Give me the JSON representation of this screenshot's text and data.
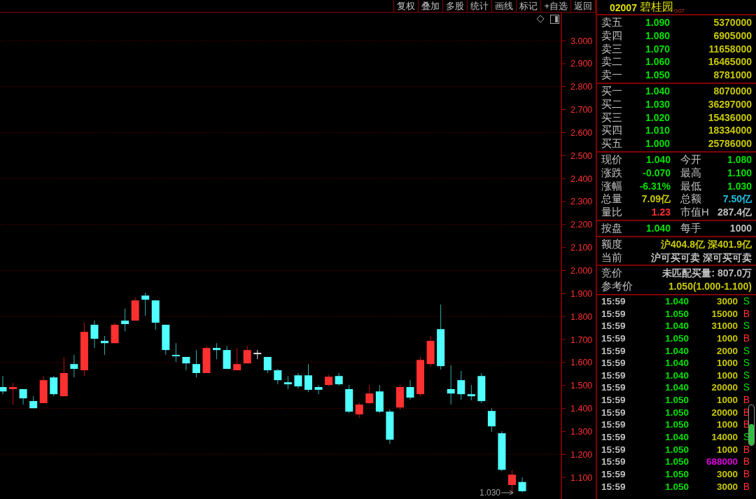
{
  "toolbar": {
    "buttons": [
      "复权",
      "叠加",
      "多股",
      "统计",
      "画线",
      "标记",
      "+自选",
      "返回"
    ]
  },
  "chart": {
    "low_marker": "1.030",
    "chart_data": {
      "type": "candlestick",
      "grid": true,
      "ylim": [
        1.006,
        3.122
      ],
      "ohlc": [
        [
          1.493,
          1.541,
          1.462,
          1.474
        ],
        [
          1.484,
          1.511,
          1.417,
          1.493
        ],
        [
          1.484,
          1.484,
          1.417,
          1.444
        ],
        [
          1.432,
          1.453,
          1.401,
          1.401
        ],
        [
          1.423,
          1.541,
          1.423,
          1.523
        ],
        [
          1.535,
          1.541,
          1.453,
          1.462
        ],
        [
          1.453,
          1.624,
          1.453,
          1.554
        ],
        [
          1.593,
          1.633,
          1.535,
          1.572
        ],
        [
          1.566,
          1.773,
          1.541,
          1.733
        ],
        [
          1.764,
          1.782,
          1.663,
          1.703
        ],
        [
          1.694,
          1.715,
          1.633,
          1.684
        ],
        [
          1.684,
          1.773,
          1.684,
          1.764
        ],
        [
          1.782,
          1.834,
          1.736,
          1.767
        ],
        [
          1.782,
          1.882,
          1.782,
          1.87
        ],
        [
          1.891,
          1.904,
          1.803,
          1.873
        ],
        [
          1.87,
          1.87,
          1.742,
          1.773
        ],
        [
          1.764,
          1.764,
          1.633,
          1.654
        ],
        [
          1.633,
          1.684,
          1.602,
          1.627
        ],
        [
          1.624,
          1.624,
          1.566,
          1.596
        ],
        [
          1.593,
          1.654,
          1.535,
          1.554
        ],
        [
          1.554,
          1.672,
          1.554,
          1.663
        ],
        [
          1.663,
          1.684,
          1.614,
          1.654
        ],
        [
          1.654,
          1.672,
          1.572,
          1.572
        ],
        [
          1.566,
          1.663,
          1.566,
          1.593
        ],
        [
          1.596,
          1.672,
          1.596,
          1.654
        ],
        [
          1.642,
          1.654,
          1.614,
          1.642
        ],
        [
          1.624,
          1.624,
          1.554,
          1.566
        ],
        [
          1.566,
          1.572,
          1.505,
          1.523
        ],
        [
          1.514,
          1.541,
          1.484,
          1.505
        ],
        [
          1.544,
          1.554,
          1.487,
          1.496
        ],
        [
          1.544,
          1.593,
          1.471,
          1.481
        ],
        [
          1.493,
          1.502,
          1.462,
          1.481
        ],
        [
          1.502,
          1.547,
          1.496,
          1.538
        ],
        [
          1.541,
          1.554,
          1.499,
          1.505
        ],
        [
          1.484,
          1.502,
          1.38,
          1.386
        ],
        [
          1.374,
          1.426,
          1.359,
          1.417
        ],
        [
          1.423,
          1.502,
          1.417,
          1.465
        ],
        [
          1.474,
          1.502,
          1.38,
          1.386
        ],
        [
          1.386,
          1.395,
          1.246,
          1.264
        ],
        [
          1.404,
          1.502,
          1.395,
          1.493
        ],
        [
          1.493,
          1.523,
          1.438,
          1.447
        ],
        [
          1.462,
          1.624,
          1.453,
          1.611
        ],
        [
          1.593,
          1.715,
          1.581,
          1.694
        ],
        [
          1.745,
          1.852,
          1.569,
          1.584
        ],
        [
          1.484,
          1.587,
          1.417,
          1.465
        ],
        [
          1.523,
          1.563,
          1.438,
          1.462
        ],
        [
          1.462,
          1.502,
          1.435,
          1.453
        ],
        [
          1.541,
          1.554,
          1.423,
          1.432
        ],
        [
          1.389,
          1.401,
          1.298,
          1.322
        ],
        [
          1.292,
          1.301,
          1.127,
          1.133
        ],
        [
          1.067,
          1.133,
          1.03,
          1.112
        ],
        [
          1.08,
          1.1,
          1.035,
          1.04
        ]
      ],
      "yticks": [
        {
          "value": 3.0,
          "label": "3.000"
        },
        {
          "value": 2.9,
          "label": "2.900"
        },
        {
          "value": 2.8,
          "label": "2.800"
        },
        {
          "value": 2.7,
          "label": "2.700"
        },
        {
          "value": 2.6,
          "label": "2.600"
        },
        {
          "value": 2.5,
          "label": "2.500"
        },
        {
          "value": 2.4,
          "label": "2.400"
        },
        {
          "value": 2.3,
          "label": "2.300"
        },
        {
          "value": 2.2,
          "label": "2.200"
        },
        {
          "value": 2.1,
          "label": "2.100"
        },
        {
          "value": 2.0,
          "label": "2.000"
        },
        {
          "value": 1.9,
          "label": "1.900"
        },
        {
          "value": 1.8,
          "label": "1.800"
        },
        {
          "value": 1.7,
          "label": "1.700"
        },
        {
          "value": 1.6,
          "label": "1.600"
        },
        {
          "value": 1.5,
          "label": "1.500"
        },
        {
          "value": 1.4,
          "label": "1.400"
        },
        {
          "value": 1.3,
          "label": "1.300"
        },
        {
          "value": 1.2,
          "label": "1.200"
        },
        {
          "value": 1.1,
          "label": "1.100"
        }
      ]
    }
  },
  "quote": {
    "code": "02007",
    "name": "碧桂园",
    "tag": "GGT"
  },
  "asks": [
    {
      "label": "卖五",
      "price": "1.090",
      "volume": "5370000"
    },
    {
      "label": "卖四",
      "price": "1.080",
      "volume": "6905000"
    },
    {
      "label": "卖三",
      "price": "1.070",
      "volume": "11658000"
    },
    {
      "label": "卖二",
      "price": "1.060",
      "volume": "16465000"
    },
    {
      "label": "卖一",
      "price": "1.050",
      "volume": "8781000"
    }
  ],
  "bids": [
    {
      "label": "买一",
      "price": "1.040",
      "volume": "8070000"
    },
    {
      "label": "买二",
      "price": "1.030",
      "volume": "36297000"
    },
    {
      "label": "买三",
      "price": "1.020",
      "volume": "15436000"
    },
    {
      "label": "买四",
      "price": "1.010",
      "volume": "18334000"
    },
    {
      "label": "买五",
      "price": "1.000",
      "volume": "25786000"
    }
  ],
  "stats": [
    {
      "label": "现价",
      "value": "1.040",
      "color": "#00e000"
    },
    {
      "label": "今开",
      "value": "1.080",
      "color": "#00e000"
    },
    {
      "label": "涨跌",
      "value": "-0.070",
      "color": "#00e000"
    },
    {
      "label": "最高",
      "value": "1.100",
      "color": "#00e000"
    },
    {
      "label": "涨幅",
      "value": "-6.31%",
      "color": "#00e000"
    },
    {
      "label": "最低",
      "value": "1.030",
      "color": "#00e000"
    },
    {
      "label": "总量",
      "value": "7.09亿",
      "color": "#c8c800"
    },
    {
      "label": "总额",
      "value": "7.50亿",
      "color": "#20c0e0"
    },
    {
      "label": "量比",
      "value": "1.23",
      "color": "#ff3030"
    },
    {
      "label": "市值H",
      "value": "287.4亿",
      "color": "#c0c0c0"
    }
  ],
  "board": {
    "label": "按盘",
    "value": "1.040",
    "lot_label": "每手",
    "lot_value": "1000"
  },
  "quota": [
    {
      "label": "额度",
      "value": "沪404.8亿 深401.9亿",
      "color": "#c8c800"
    },
    {
      "label": "当前",
      "value": "沪可买可卖 深可买可卖",
      "color": "#c0c0c0"
    }
  ],
  "auction": [
    {
      "label": "竞价",
      "value": "未匹配买量: 807.0万",
      "color": "#c0c0c0"
    },
    {
      "label": "参考价",
      "value": "1.050(1.000-1.100)",
      "color": "#c8c800"
    }
  ],
  "trades": [
    {
      "time": "15:59",
      "price": "1.040",
      "volume": "3000",
      "side": "S",
      "kind": "sell",
      "highlighted": false
    },
    {
      "time": "15:59",
      "price": "1.050",
      "volume": "15000",
      "side": "B",
      "kind": "buy",
      "highlighted": false
    },
    {
      "time": "15:59",
      "price": "1.040",
      "volume": "31000",
      "side": "S",
      "kind": "sell",
      "highlighted": false
    },
    {
      "time": "15:59",
      "price": "1.050",
      "volume": "1000",
      "side": "B",
      "kind": "buy",
      "highlighted": false
    },
    {
      "time": "15:59",
      "price": "1.040",
      "volume": "2000",
      "side": "S",
      "kind": "sell",
      "highlighted": false
    },
    {
      "time": "15:59",
      "price": "1.040",
      "volume": "1000",
      "side": "S",
      "kind": "sell",
      "highlighted": false
    },
    {
      "time": "15:59",
      "price": "1.040",
      "volume": "1000",
      "side": "S",
      "kind": "sell",
      "highlighted": false
    },
    {
      "time": "15:59",
      "price": "1.040",
      "volume": "20000",
      "side": "S",
      "kind": "sell",
      "highlighted": false
    },
    {
      "time": "15:59",
      "price": "1.050",
      "volume": "1000",
      "side": "B",
      "kind": "buy",
      "highlighted": false
    },
    {
      "time": "15:59",
      "price": "1.050",
      "volume": "20000",
      "side": "B",
      "kind": "buy",
      "highlighted": false
    },
    {
      "time": "15:59",
      "price": "1.050",
      "volume": "1000",
      "side": "B",
      "kind": "buy",
      "highlighted": false
    },
    {
      "time": "15:59",
      "price": "1.040",
      "volume": "14000",
      "side": "S",
      "kind": "sell",
      "highlighted": false
    },
    {
      "time": "15:59",
      "price": "1.050",
      "volume": "1000",
      "side": "B",
      "kind": "buy",
      "highlighted": false
    },
    {
      "time": "15:59",
      "price": "1.050",
      "volume": "688000",
      "side": "B",
      "kind": "buy",
      "highlighted": true
    },
    {
      "time": "15:59",
      "price": "1.050",
      "volume": "3000",
      "side": "B",
      "kind": "buy",
      "highlighted": false
    },
    {
      "time": "15:59",
      "price": "1.050",
      "volume": "3000",
      "side": "B",
      "kind": "buy",
      "highlighted": false
    }
  ]
}
